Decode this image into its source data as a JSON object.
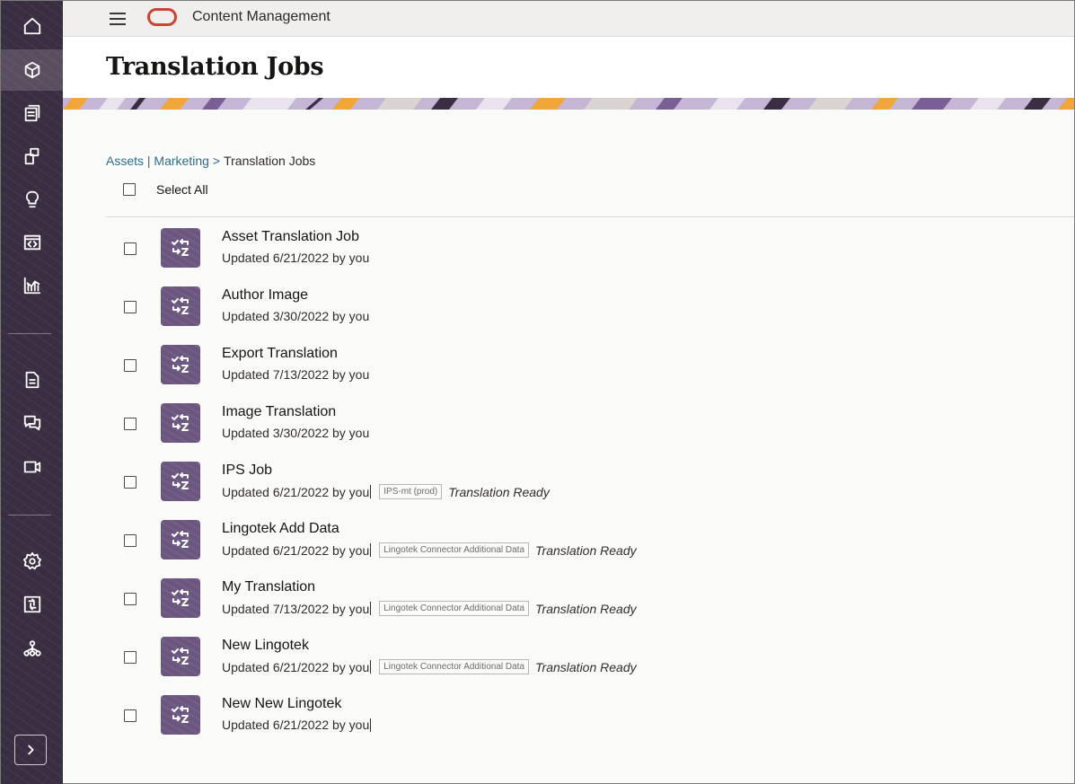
{
  "app": {
    "title": "Content Management"
  },
  "page": {
    "title": "Translation Jobs"
  },
  "breadcrumb": {
    "link": "Assets | Marketing",
    "separator": ">",
    "current": "Translation Jobs"
  },
  "select_all": {
    "label": "Select All"
  },
  "rail": {
    "items": [
      {
        "icon": "home-icon"
      },
      {
        "icon": "assets-cube-icon",
        "active": true
      },
      {
        "icon": "collections-icon"
      },
      {
        "icon": "content-types-icon"
      },
      {
        "icon": "ideas-lightbulb-icon"
      },
      {
        "icon": "sites-icon"
      },
      {
        "icon": "analytics-icon"
      },
      {
        "icon": "documents-icon"
      },
      {
        "icon": "conversations-icon"
      },
      {
        "icon": "video-icon"
      },
      {
        "icon": "settings-gear-icon"
      },
      {
        "icon": "integrations-icon"
      },
      {
        "icon": "org-hierarchy-icon"
      }
    ],
    "expand_icon": "chevron-right-icon"
  },
  "jobs": [
    {
      "title": "Asset Translation Job",
      "meta": "Updated 6/21/2022 by you",
      "tag": "",
      "status": ""
    },
    {
      "title": "Author Image",
      "meta": "Updated 3/30/2022 by you",
      "tag": "",
      "status": ""
    },
    {
      "title": "Export Translation",
      "meta": "Updated 7/13/2022 by you",
      "tag": "",
      "status": ""
    },
    {
      "title": "Image Translation",
      "meta": "Updated 3/30/2022 by you",
      "tag": "",
      "status": ""
    },
    {
      "title": "IPS Job",
      "meta": "Updated 6/21/2022 by you",
      "tag": "IPS-mt (prod)",
      "status": "Translation Ready"
    },
    {
      "title": "Lingotek Add Data",
      "meta": "Updated 6/21/2022 by you",
      "tag": "Lingotek Connector Additional Data",
      "status": "Translation Ready"
    },
    {
      "title": "My Translation",
      "meta": "Updated 7/13/2022 by you",
      "tag": "Lingotek Connector Additional Data",
      "status": "Translation Ready"
    },
    {
      "title": "New Lingotek",
      "meta": "Updated 6/21/2022 by you",
      "tag": "Lingotek Connector Additional Data",
      "status": "Translation Ready"
    },
    {
      "title": "New New Lingotek",
      "meta": "Updated 6/21/2022 by you",
      "tag": "",
      "status": ""
    }
  ],
  "colors": {
    "rail": "#3a2e42",
    "job_icon": "#6b5680",
    "oracle_red": "#c74634",
    "link": "#2f6d8c"
  }
}
